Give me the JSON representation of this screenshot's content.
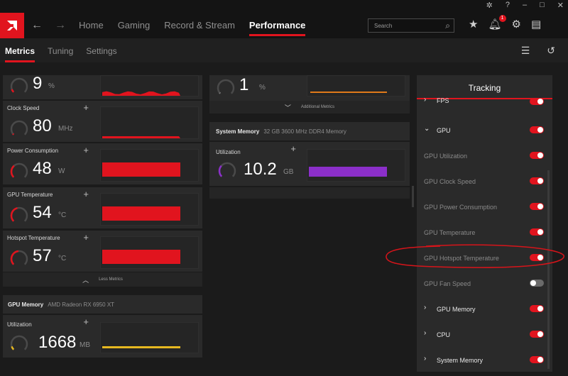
{
  "nav": {
    "items": [
      "Home",
      "Gaming",
      "Record & Stream",
      "Performance"
    ],
    "active": "Performance",
    "search_placeholder": "Search",
    "notification_count": "1"
  },
  "subnav": {
    "tabs": [
      "Metrics",
      "Tuning",
      "Settings"
    ],
    "active": "Metrics"
  },
  "gpu_metrics": [
    {
      "label": "",
      "value": "9",
      "unit": "%",
      "gauge_fraction": 0.09
    },
    {
      "label": "Clock Speed",
      "value": "80",
      "unit": "MHz",
      "gauge_fraction": 0.03
    },
    {
      "label": "Power Consumption",
      "value": "48",
      "unit": "W",
      "gauge_fraction": 0.35
    },
    {
      "label": "GPU Temperature",
      "value": "54",
      "unit": "°C",
      "gauge_fraction": 0.45
    },
    {
      "label": "Hotspot Temperature",
      "value": "57",
      "unit": "°C",
      "gauge_fraction": 0.48
    }
  ],
  "less_metrics_label": "Less Metrics",
  "gpu_memory": {
    "title": "GPU Memory",
    "subtitle": "AMD Radeon RX 6950 XT",
    "label": "Utilization",
    "value": "1668",
    "unit": "MB",
    "gauge_fraction": 0.1
  },
  "cpu_partial": {
    "value": "1",
    "unit": "%",
    "gauge_fraction": 0.01
  },
  "additional_metrics_label": "Additional Metrics",
  "system_memory": {
    "title": "System Memory",
    "subtitle": "32 GB 3600 MHz DDR4 Memory",
    "label": "Utilization",
    "value": "10.2",
    "unit": "GB",
    "gauge_fraction": 0.32
  },
  "tracking": {
    "title": "Tracking",
    "rows": [
      {
        "label": "FPS",
        "expandable": true,
        "expanded": false,
        "on": true
      },
      {
        "label": "GPU",
        "expandable": true,
        "expanded": true,
        "on": true
      },
      {
        "label": "GPU Utilization",
        "expandable": false,
        "on": true
      },
      {
        "label": "GPU Clock Speed",
        "expandable": false,
        "on": true
      },
      {
        "label": "GPU Power Consumption",
        "expandable": false,
        "on": true
      },
      {
        "label": "GPU Temperature",
        "expandable": false,
        "on": true
      },
      {
        "label": "GPU Hotspot Temperature",
        "expandable": false,
        "on": true
      },
      {
        "label": "GPU Fan Speed",
        "expandable": false,
        "on": false
      },
      {
        "label": "GPU Memory",
        "expandable": true,
        "expanded": false,
        "on": true
      },
      {
        "label": "CPU",
        "expandable": true,
        "expanded": false,
        "on": true
      },
      {
        "label": "System Memory",
        "expandable": true,
        "expanded": false,
        "on": true
      }
    ]
  },
  "colors": {
    "accent": "#e1141e",
    "memory_purple": "#8b2fc9",
    "vram_yellow": "#e6b820"
  }
}
